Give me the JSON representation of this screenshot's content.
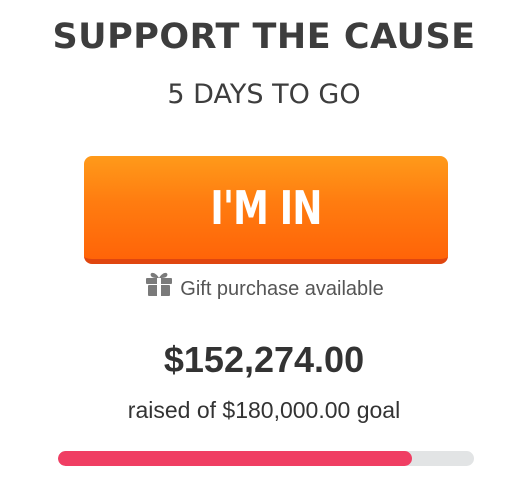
{
  "campaign": {
    "headline": "SUPPORT THE CAUSE",
    "days_remaining": "5 DAYS TO GO"
  },
  "cta": {
    "label": "I'M IN"
  },
  "gift": {
    "icon": "gift-icon",
    "text": "Gift purchase available"
  },
  "funding": {
    "raised": "$152,274.00",
    "goal_text": "raised of $180,000.00 goal",
    "progress_percent": 85
  },
  "colors": {
    "button_orange": "#ff7c10",
    "progress_fill": "#f03e63",
    "progress_track": "#e2e4e5"
  }
}
